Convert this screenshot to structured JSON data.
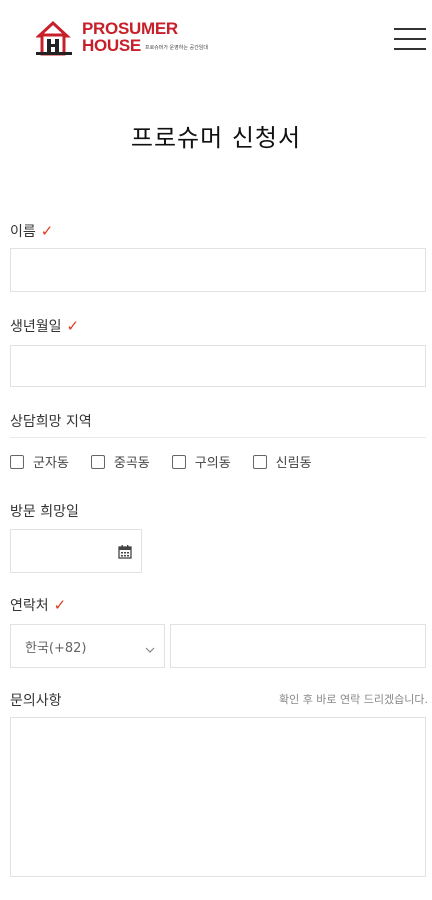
{
  "brand": {
    "line1": "PROSUMER",
    "line2": "HOUSE",
    "tagline": "프로슈머가 운영하는 공간임대",
    "color": "#c8202b"
  },
  "header": {
    "menu_icon": "hamburger-menu-icon"
  },
  "page": {
    "title": "프로슈머 신청서"
  },
  "form": {
    "required_mark": "✓",
    "required_color": "#e23a1c",
    "name": {
      "label": "이름"
    },
    "birth": {
      "label": "생년월일"
    },
    "region": {
      "label": "상담희망 지역",
      "options": [
        "군자동",
        "중곡동",
        "구의동",
        "신림동"
      ]
    },
    "visit": {
      "label": "방문 희망일",
      "icon": "calendar-icon"
    },
    "contact": {
      "label": "연락처",
      "country": "한국(+82)",
      "dropdown_icon": "chevron-down-icon"
    },
    "inquiry": {
      "label": "문의사항",
      "note": "확인 후 바로 연락 드리겠습니다."
    }
  }
}
